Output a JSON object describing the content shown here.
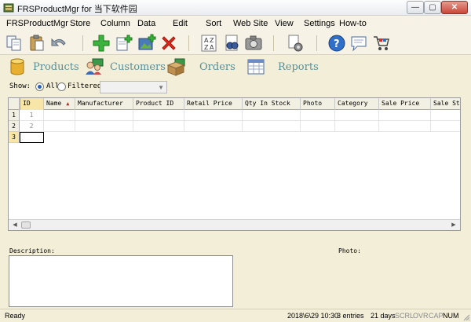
{
  "window": {
    "title": "FRSProductMgr for 当下软件园",
    "minimize_glyph": "—",
    "maximize_glyph": "▢",
    "close_glyph": "✕"
  },
  "menu": [
    "FRSProductMgr",
    "Store",
    "Column",
    "Data",
    "Edit",
    "Sort",
    "Web Site",
    "View",
    "Settings",
    "How-to"
  ],
  "toolbar": [
    {
      "name": "copy-icon"
    },
    {
      "name": "paste-icon"
    },
    {
      "name": "undo-icon"
    },
    {
      "name": "add-icon"
    },
    {
      "name": "new-record-icon"
    },
    {
      "name": "add-image-icon"
    },
    {
      "name": "delete-icon"
    },
    {
      "name": "sort-az-icon"
    },
    {
      "name": "find-icon"
    },
    {
      "name": "photo-icon"
    },
    {
      "name": "settings-icon"
    },
    {
      "name": "help-icon"
    },
    {
      "name": "chat-icon"
    },
    {
      "name": "cart-icon"
    }
  ],
  "sections": [
    {
      "label": "Products",
      "icon": "database-icon"
    },
    {
      "label": "Customers",
      "icon": "customers-icon"
    },
    {
      "label": "Orders",
      "icon": "orders-icon"
    },
    {
      "label": "Reports",
      "icon": "reports-icon"
    }
  ],
  "filter": {
    "show_label": "Show:",
    "all_label": "All",
    "filtered_label": "Filtered :",
    "selected": "all",
    "combo_value": ""
  },
  "grid": {
    "columns": [
      "ID",
      "Name",
      "Manufacturer",
      "Product ID",
      "Retail Price",
      "Qty In Stock",
      "Photo",
      "Category",
      "Sale Price",
      "Sale Sto"
    ],
    "sort_column": "Name",
    "sort_glyph": "▲",
    "rows": [
      {
        "row": "1",
        "id": "1"
      },
      {
        "row": "2",
        "id": "2"
      },
      {
        "row": "3",
        "id": ""
      }
    ],
    "current_row": "3",
    "scroll_left": "◀",
    "scroll_right": "▶"
  },
  "details": {
    "description_label": "Description:",
    "photo_label": "Photo:"
  },
  "status": {
    "ready": "Ready",
    "datetime": "2018\\6\\29 10:30",
    "entries": "3 entries",
    "days": "21 days",
    "scrl": "SCRL",
    "ovr": "OVR",
    "cap": "CAP",
    "num": "NUM"
  },
  "colors": {
    "accent_teal": "#5a8f96",
    "background": "#f3eed8",
    "selected_header": "#f8e6a8"
  }
}
